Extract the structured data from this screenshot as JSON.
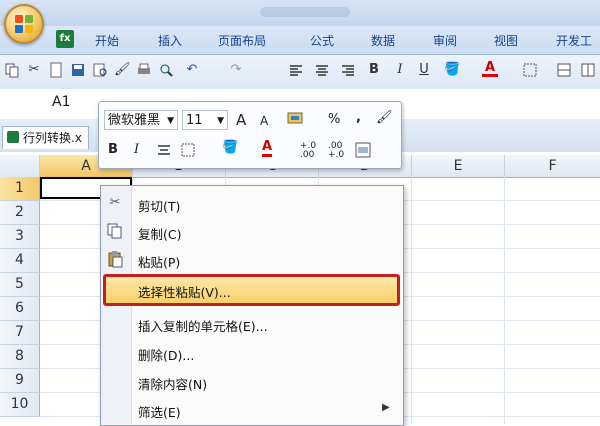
{
  "ribbon": {
    "file_badge": "fx",
    "tabs": [
      "开始",
      "插入",
      "页面布局",
      "公式",
      "数据",
      "审阅",
      "视图",
      "开发工"
    ]
  },
  "toolbar": {
    "bold": "B",
    "italic": "I",
    "underline": "U",
    "font_color_glyph": "A"
  },
  "name_box": {
    "value": "A1"
  },
  "workbook_tab": {
    "label": "行列转换.x"
  },
  "grid": {
    "columns": [
      "A",
      "B",
      "C",
      "D",
      "E",
      "F"
    ],
    "rows": [
      "1",
      "2",
      "3",
      "4",
      "5",
      "6",
      "7",
      "8",
      "9",
      "10"
    ],
    "active_cell": "A1"
  },
  "mini_toolbar": {
    "font_name": "微软雅黑",
    "font_size": "11",
    "grow_font": "A",
    "shrink_font": "A",
    "percent": "%",
    "comma": ",",
    "bold": "B",
    "italic": "I",
    "font_color_glyph": "A",
    "increase_decimal": "+.0 .00",
    "decrease_decimal": ".00 +.0"
  },
  "context_menu": {
    "items": [
      {
        "label": "剪切(T)"
      },
      {
        "label": "复制(C)"
      },
      {
        "label": "粘贴(P)"
      },
      {
        "label": "选择性粘贴(V)..."
      },
      {
        "label": "插入复制的单元格(E)..."
      },
      {
        "label": "删除(D)..."
      },
      {
        "label": "清除内容(N)"
      },
      {
        "label": "筛选(E)"
      }
    ],
    "highlighted_index": 3
  },
  "colors": {
    "highlight_border": "#c02020",
    "highlight_fill": "#f8d06a",
    "ribbon_text": "#15428b"
  }
}
